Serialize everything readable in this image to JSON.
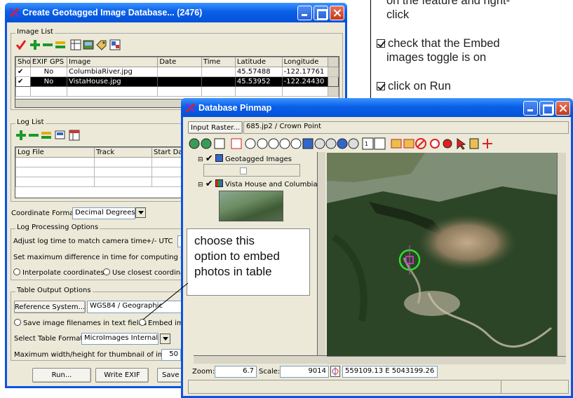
{
  "instructions": {
    "line1a": "on the feature and right-",
    "line1b": "click",
    "item2a": "check that the Embed",
    "item2b": "images toggle is on",
    "item3": "click on Run"
  },
  "db_window": {
    "title": "Create Geotagged Image Database... (2476)",
    "image_list_label": "Image List",
    "columns": [
      "Show",
      "EXIF GPS",
      "Image",
      "Date",
      "Time",
      "Latitude",
      "Longitude"
    ],
    "rows": [
      {
        "show": "✔",
        "exif": "No",
        "image": "ColumbiaRiver.jpg",
        "date": "",
        "time": "",
        "lat": "45.57488",
        "lon": "-122.17761"
      },
      {
        "show": "✔",
        "exif": "No",
        "image": "VistaHouse.jpg",
        "date": "",
        "time": "",
        "lat": "45.53952",
        "lon": "-122.24430"
      }
    ],
    "log_list_label": "Log List",
    "log_columns": [
      "Log File",
      "Track",
      "Start Date"
    ],
    "coord_format_label": "Coordinate Format",
    "coord_format_value": "Decimal Degrees",
    "log_processing_label": "Log Processing Options",
    "adjust_label": "Adjust log time to match camera time",
    "utc_label": "+/- UTC",
    "max_diff_label": "Set maximum difference in time for computing coordina",
    "interpolate_label": "Interpolate coordinates",
    "closest_label": "Use closest coordinate",
    "table_output_label": "Table Output Options",
    "ref_system_button": "Reference System...",
    "ref_system_value": "WGS84 / Geographic",
    "save_filenames_label": "Save image filenames in text fields",
    "embed_label": "Embed imag",
    "table_format_label": "Select Table Format",
    "table_format_value": "MicroImages Internal",
    "max_thumb_label": "Maximum width/height for thumbnail of image",
    "max_thumb_value": "50",
    "run_button": "Run...",
    "write_exif_button": "Write EXIF",
    "save_button": "Save KI"
  },
  "pinmap": {
    "title": "Database Pinmap",
    "input_raster_button": "Input Raster...",
    "input_raster_value": "685.jp2 / Crown Point",
    "layer1": "Geotagged Images",
    "layer2": "Vista House and Columbia",
    "zoom_label": "Zoom:",
    "zoom_value": "6.7",
    "scale_label": "Scale:",
    "scale_value": "9014",
    "coords": "559109.13 E  5043199.26 N m"
  },
  "callout": {
    "line1": "choose this",
    "line2": "option to embed",
    "line3": "photos in table"
  },
  "colors": {
    "titlebar": "#0a5fe8",
    "window_bg": "#ece9d8",
    "pin_ring": "#33dd33",
    "pin_square": "#cc44cc"
  }
}
